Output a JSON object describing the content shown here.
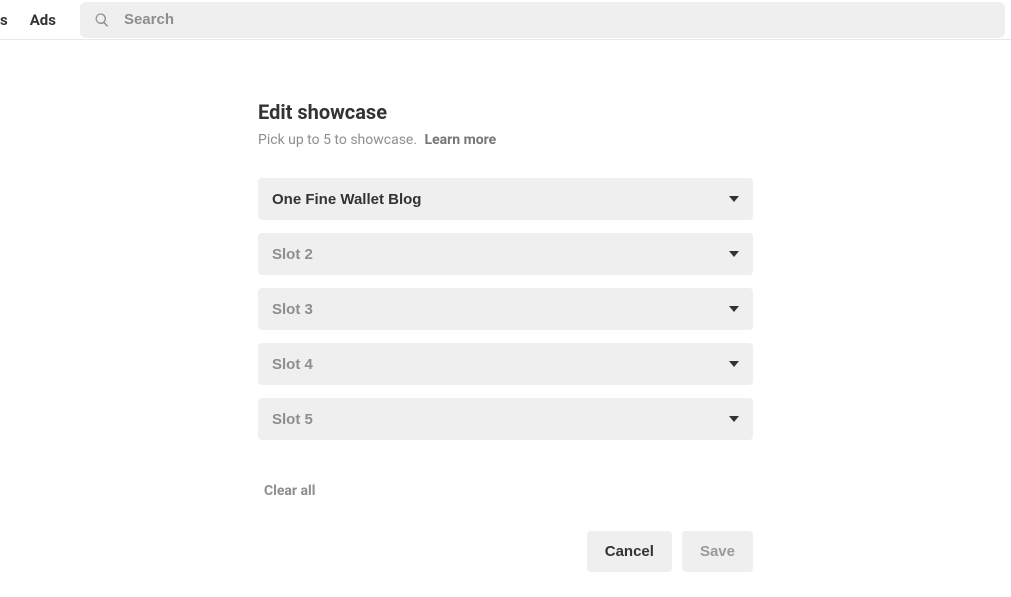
{
  "header": {
    "nav_truncated": "s",
    "nav_item": "Ads",
    "search_placeholder": "Search"
  },
  "main": {
    "title": "Edit showcase",
    "subtitle": "Pick up to 5 to showcase.",
    "learn_more": "Learn more",
    "slots": {
      "0": {
        "label": "One Fine Wallet Blog",
        "filled": true
      },
      "1": {
        "label": "Slot 2",
        "filled": false
      },
      "2": {
        "label": "Slot 3",
        "filled": false
      },
      "3": {
        "label": "Slot 4",
        "filled": false
      },
      "4": {
        "label": "Slot 5",
        "filled": false
      }
    },
    "clear_all": "Clear all",
    "cancel": "Cancel",
    "save": "Save"
  }
}
